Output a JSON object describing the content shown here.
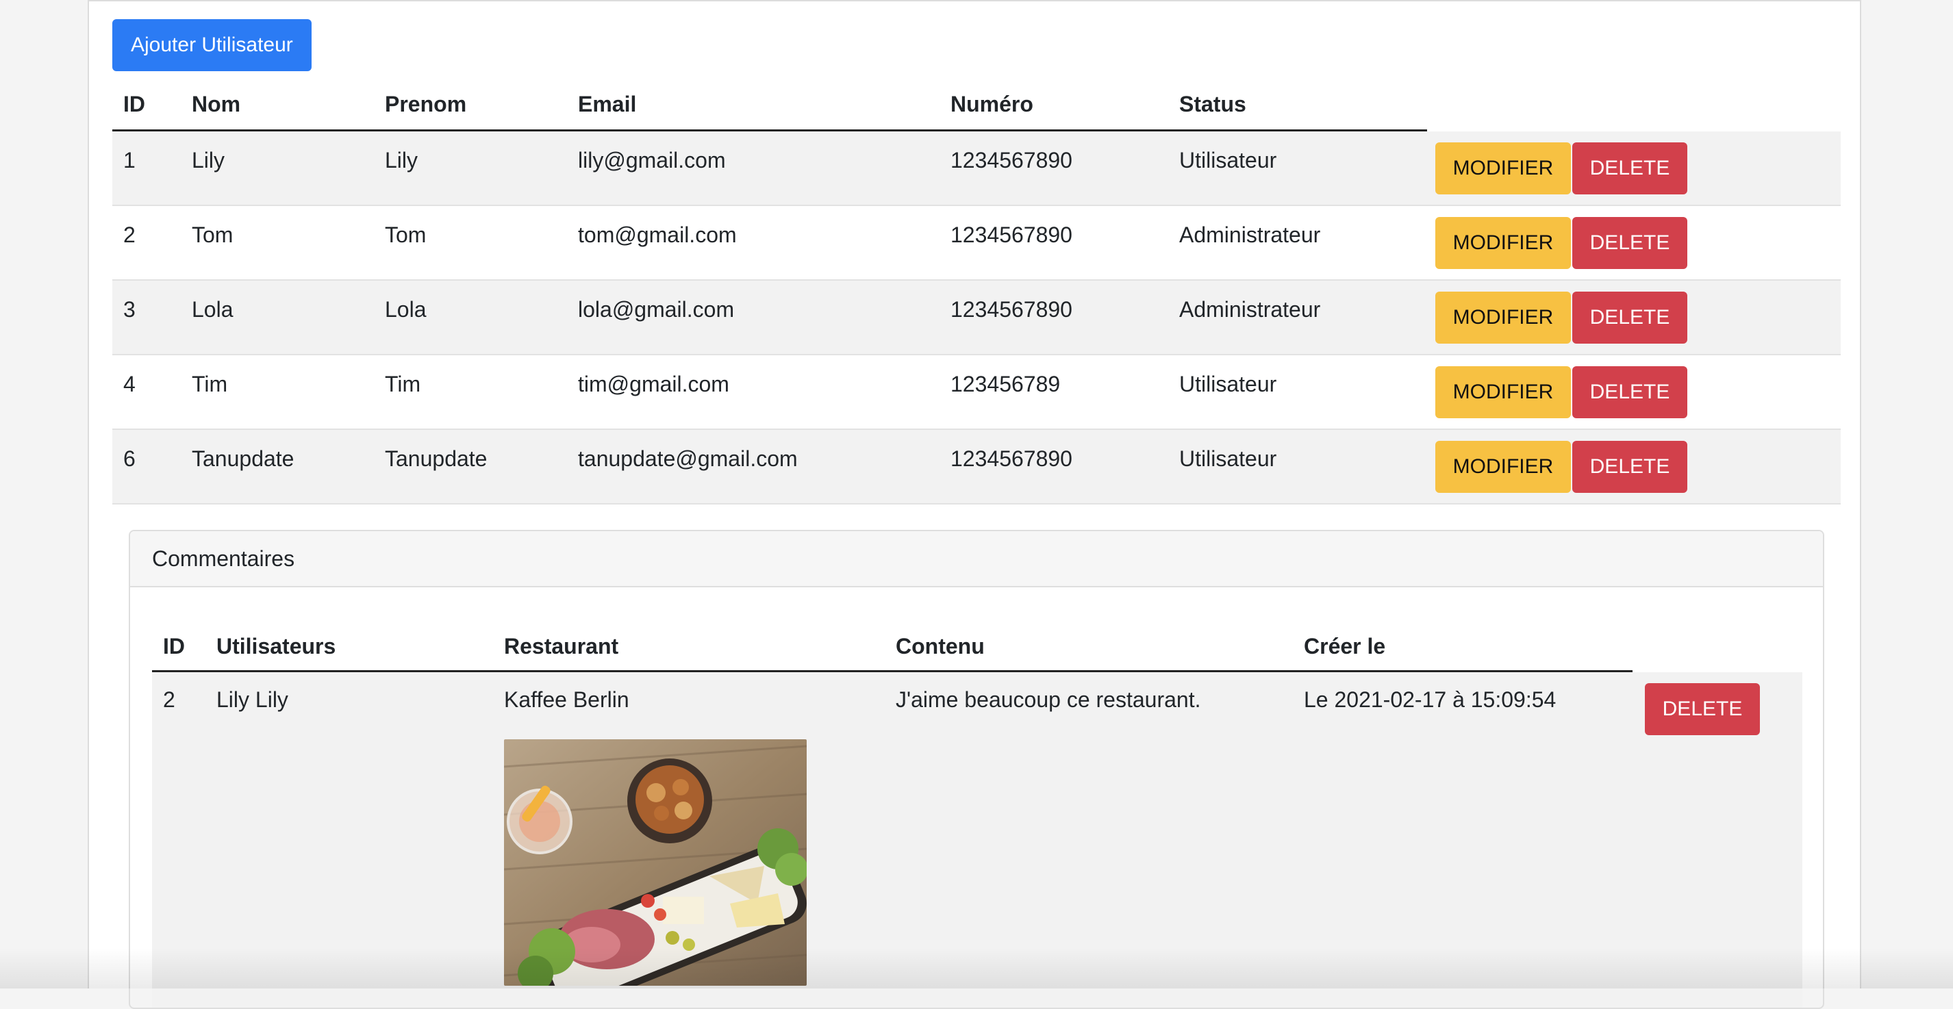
{
  "toolbar": {
    "add_user_label": "Ajouter Utilisateur"
  },
  "users_table": {
    "headers": {
      "id": "ID",
      "nom": "Nom",
      "prenom": "Prenom",
      "email": "Email",
      "numero": "Numéro",
      "status": "Status"
    },
    "modify_label": "MODIFIER",
    "delete_label": "DELETE",
    "rows": [
      {
        "id": "1",
        "nom": "Lily",
        "prenom": "Lily",
        "email": "lily@gmail.com",
        "numero": "1234567890",
        "status": "Utilisateur"
      },
      {
        "id": "2",
        "nom": "Tom",
        "prenom": "Tom",
        "email": "tom@gmail.com",
        "numero": "1234567890",
        "status": "Administrateur"
      },
      {
        "id": "3",
        "nom": "Lola",
        "prenom": "Lola",
        "email": "lola@gmail.com",
        "numero": "1234567890",
        "status": "Administrateur"
      },
      {
        "id": "4",
        "nom": "Tim",
        "prenom": "Tim",
        "email": "tim@gmail.com",
        "numero": "123456789",
        "status": "Utilisateur"
      },
      {
        "id": "6",
        "nom": "Tanupdate",
        "prenom": "Tanupdate",
        "email": "tanupdate@gmail.com",
        "numero": "1234567890",
        "status": "Utilisateur"
      }
    ]
  },
  "comments_card": {
    "title": "Commentaires",
    "headers": {
      "id": "ID",
      "utilisateurs": "Utilisateurs",
      "restaurant": "Restaurant",
      "contenu": "Contenu",
      "cree_le": "Créer le"
    },
    "delete_label": "DELETE",
    "rows": [
      {
        "id": "2",
        "utilisateur": "Lily Lily",
        "restaurant": "Kaffee Berlin",
        "contenu": "J'aime beaucoup ce restaurant.",
        "cree_le": "Le 2021-02-17 à 15:09:54"
      }
    ]
  },
  "colors": {
    "primary": "#2b7bf4",
    "warning": "#f7c142",
    "danger": "#d2404b",
    "stripe": "#f2f2f2"
  }
}
